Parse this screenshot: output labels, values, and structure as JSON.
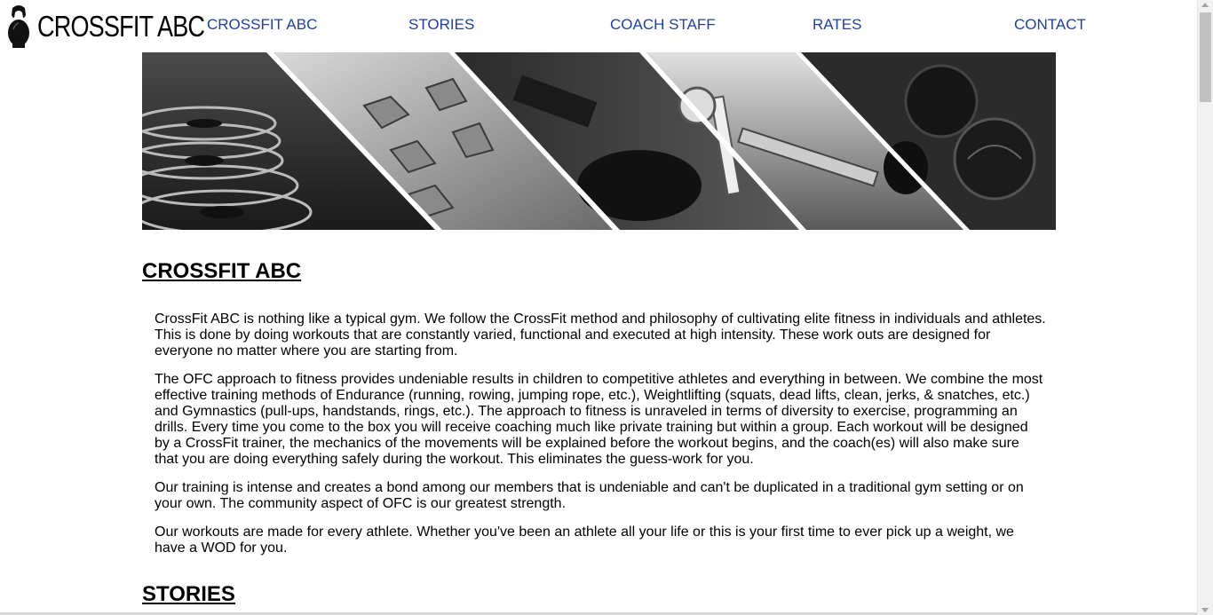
{
  "logo": {
    "text": "CROSSFIT ABC",
    "icon": "kettlebell-icon"
  },
  "nav": {
    "items": [
      {
        "label": "CROSSFIT ABC"
      },
      {
        "label": "STORIES"
      },
      {
        "label": "COACH STAFF"
      },
      {
        "label": "RATES"
      },
      {
        "label": "CONTACT"
      }
    ]
  },
  "hero": {
    "description_icon": "gym-equipment-collage"
  },
  "about": {
    "title": "CROSSFIT ABC",
    "paragraphs": [
      "CrossFit ABC is nothing like a typical gym. We follow the CrossFit method and philosophy of cultivating elite fitness in individuals and athletes. This is done by doing workouts that are constantly varied, functional and executed at high intensity. These work outs are designed for everyone no matter where you are starting from.",
      "The OFC approach to fitness provides undeniable results in children to competitive athletes and everything in between. We combine the most effective training methods of Endurance (running, rowing, jumping rope, etc.), Weightlifting (squats, dead lifts, clean, jerks, & snatches, etc.) and Gymnastics (pull-ups, handstands, rings, etc.). The approach to fitness is unraveled in terms of diversity to exercise, programming an drills. Every time you come to the box you will receive coaching much like private training but within a group. Each workout will be designed by a CrossFit trainer, the mechanics of the movements will be explained before the workout begins, and the coach(es) will also make sure that you are doing everything safely during the workout. This eliminates the guess-work for you.",
      "Our training is intense and creates a bond among our members that is undeniable and can't be duplicated in a traditional gym setting or on your own. The community aspect of OFC is our greatest strength.",
      "Our workouts are made for every athlete. Whether you've been an athlete all your life or this is your first time to ever pick up a weight, we have a WOD for you."
    ]
  },
  "stories": {
    "title": "STORIES"
  },
  "colors": {
    "nav_link": "#1f3fa8",
    "text": "#000000",
    "background": "#ffffff"
  }
}
